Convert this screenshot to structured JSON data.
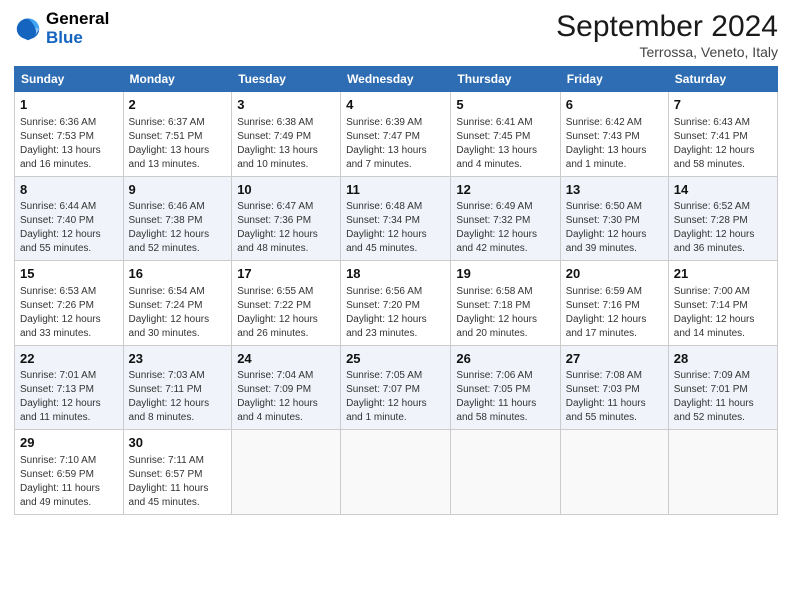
{
  "header": {
    "logo_general": "General",
    "logo_blue": "Blue",
    "month_title": "September 2024",
    "location": "Terrossa, Veneto, Italy"
  },
  "days_of_week": [
    "Sunday",
    "Monday",
    "Tuesday",
    "Wednesday",
    "Thursday",
    "Friday",
    "Saturday"
  ],
  "weeks": [
    [
      {
        "day": "1",
        "info": "Sunrise: 6:36 AM\nSunset: 7:53 PM\nDaylight: 13 hours\nand 16 minutes."
      },
      {
        "day": "2",
        "info": "Sunrise: 6:37 AM\nSunset: 7:51 PM\nDaylight: 13 hours\nand 13 minutes."
      },
      {
        "day": "3",
        "info": "Sunrise: 6:38 AM\nSunset: 7:49 PM\nDaylight: 13 hours\nand 10 minutes."
      },
      {
        "day": "4",
        "info": "Sunrise: 6:39 AM\nSunset: 7:47 PM\nDaylight: 13 hours\nand 7 minutes."
      },
      {
        "day": "5",
        "info": "Sunrise: 6:41 AM\nSunset: 7:45 PM\nDaylight: 13 hours\nand 4 minutes."
      },
      {
        "day": "6",
        "info": "Sunrise: 6:42 AM\nSunset: 7:43 PM\nDaylight: 13 hours\nand 1 minute."
      },
      {
        "day": "7",
        "info": "Sunrise: 6:43 AM\nSunset: 7:41 PM\nDaylight: 12 hours\nand 58 minutes."
      }
    ],
    [
      {
        "day": "8",
        "info": "Sunrise: 6:44 AM\nSunset: 7:40 PM\nDaylight: 12 hours\nand 55 minutes."
      },
      {
        "day": "9",
        "info": "Sunrise: 6:46 AM\nSunset: 7:38 PM\nDaylight: 12 hours\nand 52 minutes."
      },
      {
        "day": "10",
        "info": "Sunrise: 6:47 AM\nSunset: 7:36 PM\nDaylight: 12 hours\nand 48 minutes."
      },
      {
        "day": "11",
        "info": "Sunrise: 6:48 AM\nSunset: 7:34 PM\nDaylight: 12 hours\nand 45 minutes."
      },
      {
        "day": "12",
        "info": "Sunrise: 6:49 AM\nSunset: 7:32 PM\nDaylight: 12 hours\nand 42 minutes."
      },
      {
        "day": "13",
        "info": "Sunrise: 6:50 AM\nSunset: 7:30 PM\nDaylight: 12 hours\nand 39 minutes."
      },
      {
        "day": "14",
        "info": "Sunrise: 6:52 AM\nSunset: 7:28 PM\nDaylight: 12 hours\nand 36 minutes."
      }
    ],
    [
      {
        "day": "15",
        "info": "Sunrise: 6:53 AM\nSunset: 7:26 PM\nDaylight: 12 hours\nand 33 minutes."
      },
      {
        "day": "16",
        "info": "Sunrise: 6:54 AM\nSunset: 7:24 PM\nDaylight: 12 hours\nand 30 minutes."
      },
      {
        "day": "17",
        "info": "Sunrise: 6:55 AM\nSunset: 7:22 PM\nDaylight: 12 hours\nand 26 minutes."
      },
      {
        "day": "18",
        "info": "Sunrise: 6:56 AM\nSunset: 7:20 PM\nDaylight: 12 hours\nand 23 minutes."
      },
      {
        "day": "19",
        "info": "Sunrise: 6:58 AM\nSunset: 7:18 PM\nDaylight: 12 hours\nand 20 minutes."
      },
      {
        "day": "20",
        "info": "Sunrise: 6:59 AM\nSunset: 7:16 PM\nDaylight: 12 hours\nand 17 minutes."
      },
      {
        "day": "21",
        "info": "Sunrise: 7:00 AM\nSunset: 7:14 PM\nDaylight: 12 hours\nand 14 minutes."
      }
    ],
    [
      {
        "day": "22",
        "info": "Sunrise: 7:01 AM\nSunset: 7:13 PM\nDaylight: 12 hours\nand 11 minutes."
      },
      {
        "day": "23",
        "info": "Sunrise: 7:03 AM\nSunset: 7:11 PM\nDaylight: 12 hours\nand 8 minutes."
      },
      {
        "day": "24",
        "info": "Sunrise: 7:04 AM\nSunset: 7:09 PM\nDaylight: 12 hours\nand 4 minutes."
      },
      {
        "day": "25",
        "info": "Sunrise: 7:05 AM\nSunset: 7:07 PM\nDaylight: 12 hours\nand 1 minute."
      },
      {
        "day": "26",
        "info": "Sunrise: 7:06 AM\nSunset: 7:05 PM\nDaylight: 11 hours\nand 58 minutes."
      },
      {
        "day": "27",
        "info": "Sunrise: 7:08 AM\nSunset: 7:03 PM\nDaylight: 11 hours\nand 55 minutes."
      },
      {
        "day": "28",
        "info": "Sunrise: 7:09 AM\nSunset: 7:01 PM\nDaylight: 11 hours\nand 52 minutes."
      }
    ],
    [
      {
        "day": "29",
        "info": "Sunrise: 7:10 AM\nSunset: 6:59 PM\nDaylight: 11 hours\nand 49 minutes."
      },
      {
        "day": "30",
        "info": "Sunrise: 7:11 AM\nSunset: 6:57 PM\nDaylight: 11 hours\nand 45 minutes."
      },
      null,
      null,
      null,
      null,
      null
    ]
  ]
}
